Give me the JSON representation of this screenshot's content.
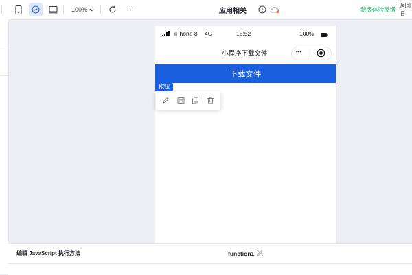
{
  "toolbar": {
    "zoom_label": "100%",
    "more_label": "···",
    "app_title": "应用相关",
    "feedback_label": "新版体验反馈",
    "back_label": "返回旧"
  },
  "phone": {
    "device_label": "iPhone 8",
    "network": "4G",
    "time": "15:52",
    "battery_pct": "100%",
    "page_title": "小程序下载文件",
    "more_glyph": "•••",
    "primary_button_label": "下载文件"
  },
  "selection": {
    "tag_label": "按钮",
    "tools": [
      "edit-icon",
      "save-icon",
      "copy-icon",
      "delete-icon"
    ]
  },
  "bottom_panel": {
    "title": "编辑 JavaScript 执行方法",
    "function_name": "function1"
  },
  "colors": {
    "primary_blue": "#1a5fe0",
    "feedback_green": "#15b26b",
    "canvas_bg": "#eceef3"
  }
}
